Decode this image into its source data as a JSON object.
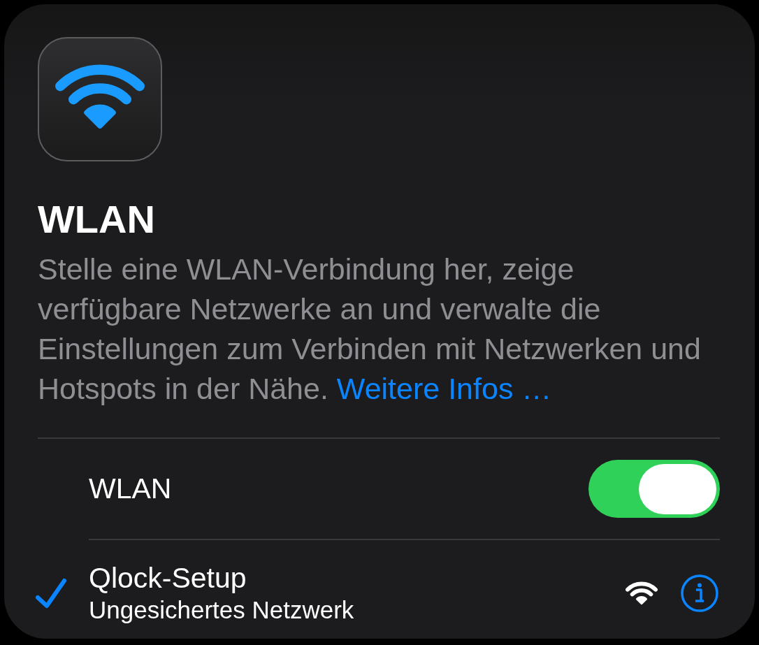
{
  "header": {
    "title": "WLAN",
    "description": "Stelle eine WLAN-Verbindung her, zeige verfügbare Netzwerke an und verwalte die Einstellungen zum Verbinden mit Netzwerken und Hotspots in der Nähe.",
    "link": "Weitere Infos …"
  },
  "wlan_toggle": {
    "label": "WLAN",
    "on": true
  },
  "networks": [
    {
      "name": "Qlock-Setup",
      "subtitle": "Ungesichertes Netzwerk",
      "selected": true
    }
  ]
}
